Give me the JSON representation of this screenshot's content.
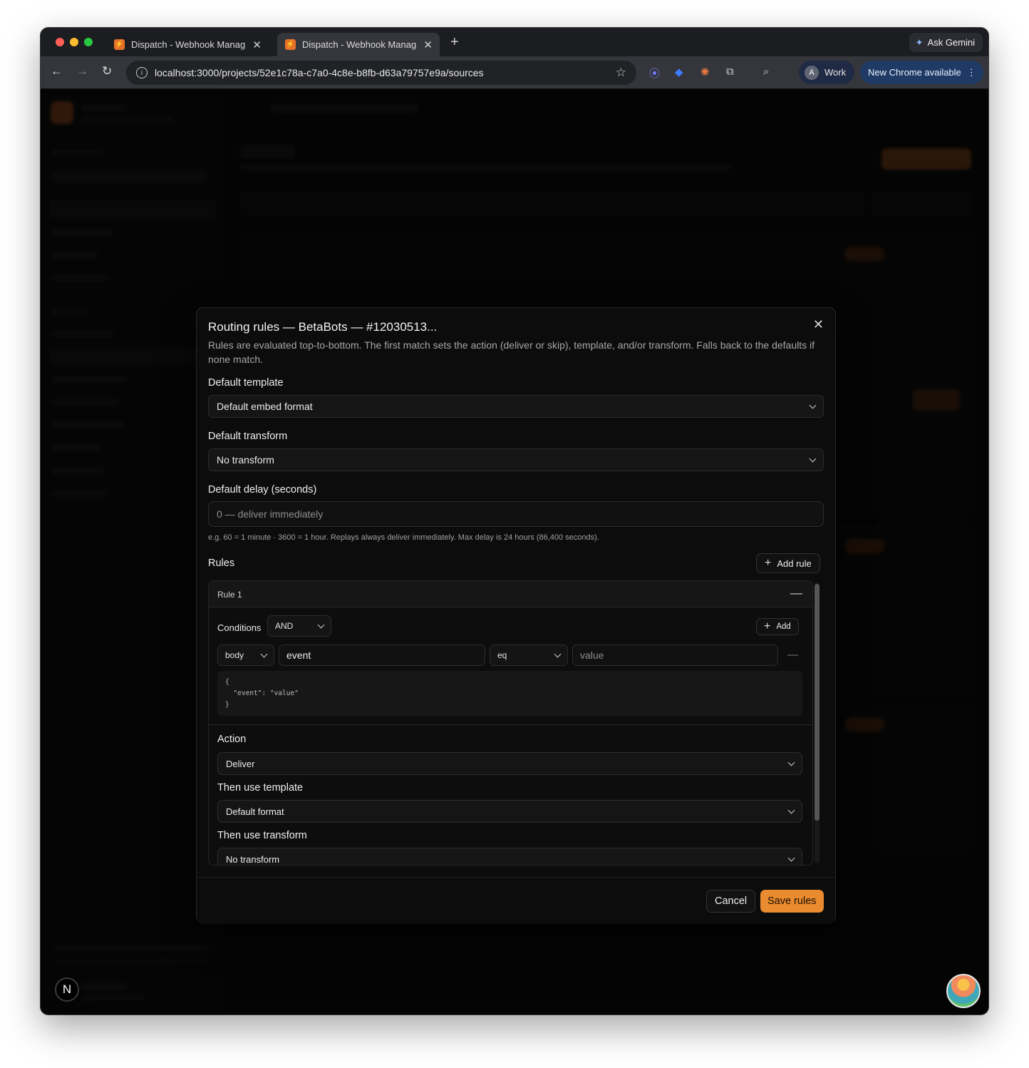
{
  "browser": {
    "tabs": [
      {
        "title": "Dispatch - Webhook Manager"
      },
      {
        "title": "Dispatch - Webhook Manager"
      }
    ],
    "url": "localhost:3000/projects/52e1c78a-c7a0-4c8e-b8fb-d63a79757e9a/sources",
    "gemini_label": "Ask Gemini",
    "profile_initial": "A",
    "profile_label": "Work",
    "update_label": "New Chrome available"
  },
  "dialog": {
    "title": "Routing rules — BetaBots — #12030513...",
    "description": "Rules are evaluated top-to-bottom. The first match sets the action (deliver or skip), template, and/or transform. Falls back to the defaults if none match.",
    "default_template_label": "Default template",
    "default_template_value": "Default embed format",
    "default_transform_label": "Default transform",
    "default_transform_value": "No transform",
    "default_delay_label": "Default delay (seconds)",
    "default_delay_placeholder": "0 — deliver immediately",
    "delay_hint": "e.g. 60 = 1 minute · 3600 = 1 hour. Replays always deliver immediately. Max delay is 24 hours (86,400 seconds).",
    "rules_label": "Rules",
    "add_rule_label": "Add rule",
    "rule": {
      "name": "Rule 1",
      "conditions_label": "Conditions",
      "logic_value": "AND",
      "add_label": "Add",
      "condition": {
        "source": "body",
        "path": "event",
        "operator": "eq",
        "value_placeholder": "value"
      },
      "preview": "{\n  \"event\": \"value\"\n}",
      "action_label": "Action",
      "action_value": "Deliver",
      "template_label": "Then use template",
      "template_value": "Default format",
      "transform_label": "Then use transform",
      "transform_value": "No transform"
    },
    "cancel_label": "Cancel",
    "save_label": "Save rules"
  },
  "colors": {
    "accent": "#e98b2e",
    "background": "#080808",
    "dialog": "#0c0c0c"
  }
}
